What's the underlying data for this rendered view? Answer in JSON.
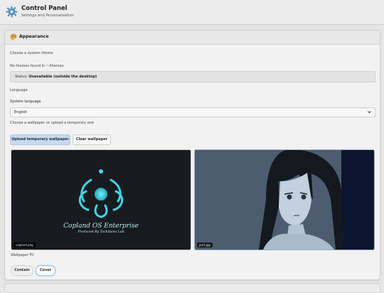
{
  "header": {
    "title": "Control Panel",
    "subtitle": "Settings and Personalization",
    "icon": "gear-icon"
  },
  "appearance": {
    "title": "Appearance",
    "icon": "palette-icon",
    "theme_label": "Choose a system theme",
    "no_themes": "No themes found in ~/themes.",
    "status_label": "Status:",
    "status_value": "Unavailable (outside the desktop)",
    "language_heading": "Language",
    "system_language_label": "System language",
    "language_selected": "English",
    "wallpaper_label": "Choose a wallpaper or upload a temporary one",
    "upload_button": "Upload temporary wallpaper",
    "clear_button": "Clear wallpaper",
    "wallpapers": [
      {
        "file": "copland.png",
        "title": "Copland OS Enterprise",
        "subtitle": "Produced By Tachibana Lab"
      },
      {
        "file": "port.jpg"
      }
    ],
    "fit_label": "Wallpaper Fit",
    "fit_options": [
      "Contain",
      "Cover"
    ],
    "fit_selected": "Cover"
  },
  "colors": {
    "accent_button": "#c9d9ee",
    "selected_outline": "#9ec3e8",
    "logo_cyan": "#3fd6e6"
  }
}
